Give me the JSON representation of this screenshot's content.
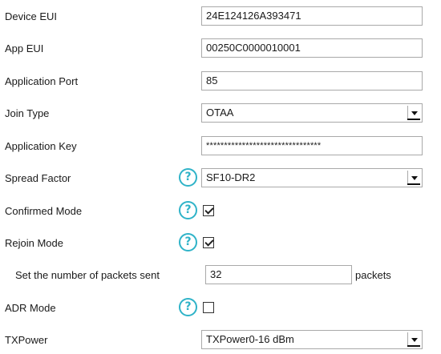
{
  "form": {
    "device_eui": {
      "label": "Device EUI",
      "value": "24E124126A393471"
    },
    "app_eui": {
      "label": "App EUI",
      "value": "00250C0000010001"
    },
    "application_port": {
      "label": "Application Port",
      "value": "85"
    },
    "join_type": {
      "label": "Join Type",
      "value": "OTAA"
    },
    "application_key": {
      "label": "Application Key",
      "value": "********************************"
    },
    "spread_factor": {
      "label": "Spread Factor",
      "value": "SF10-DR2",
      "help": "?"
    },
    "confirmed_mode": {
      "label": "Confirmed Mode",
      "checked": true,
      "help": "?"
    },
    "rejoin_mode": {
      "label": "Rejoin Mode",
      "checked": true,
      "help": "?"
    },
    "packets_sent": {
      "label": "Set the number of packets sent",
      "value": "32",
      "unit": "packets"
    },
    "adr_mode": {
      "label": "ADR Mode",
      "checked": false,
      "help": "?"
    },
    "txpower": {
      "label": "TXPower",
      "value": "TXPower0-16 dBm"
    }
  },
  "colors": {
    "help_icon": "#2fb3c8",
    "field_border": "#a9a9a9",
    "text": "#1a1a1a"
  }
}
